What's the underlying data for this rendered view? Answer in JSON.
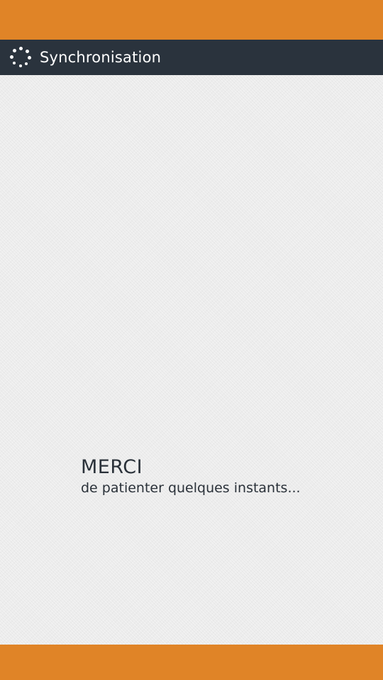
{
  "colors": {
    "accent": "#e08427",
    "title_bar": "#2a333d",
    "background": "#ececec",
    "text": "#2a3139"
  },
  "header": {
    "icon": "loading-spinner-icon",
    "title": "Synchronisation"
  },
  "message": {
    "title": "MERCI",
    "subtitle": "de patienter quelques instants..."
  }
}
